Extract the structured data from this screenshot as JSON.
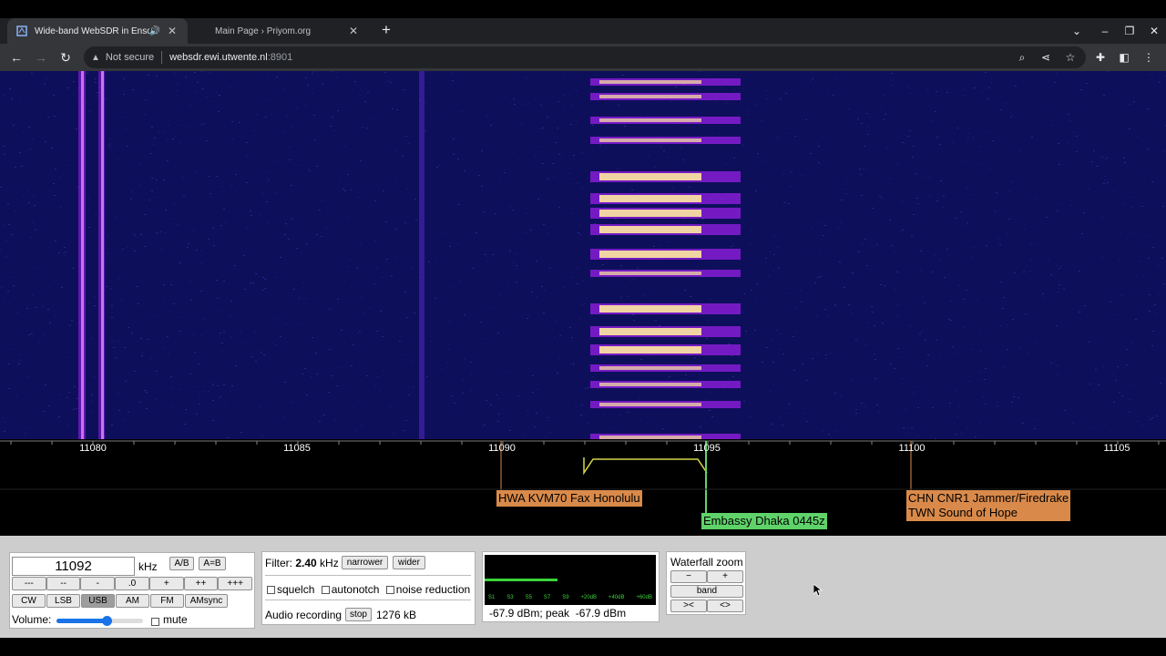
{
  "browser": {
    "tabs": [
      {
        "title": "Wide-band WebSDR in Ensch",
        "active": true,
        "audio": true
      },
      {
        "title": "Main Page › Priyom.org",
        "active": false
      }
    ],
    "address": {
      "security": "Not secure",
      "host": "websdr.ewi.utwente.nl",
      "port": ":8901"
    }
  },
  "waterfall": {
    "freq_ticks": [
      "11080",
      "11085",
      "11090",
      "11095",
      "11100",
      "11105"
    ],
    "colors": {
      "background": "#0e0f5a",
      "signal": "#ffe9a0",
      "mid": "#a020f0"
    }
  },
  "stations": [
    {
      "label": "HWA KVM70 Fax Honolulu",
      "color": "#d98a4a"
    },
    {
      "label": "Embassy Dhaka 0445z",
      "color": "#5fd36a"
    },
    {
      "label_line1": "CHN CNR1 Jammer/Firedrake",
      "label_line2": "TWN Sound of Hope",
      "color": "#d98a4a"
    }
  ],
  "tuning": {
    "frequency": "11092",
    "unit": "kHz",
    "ab": "A/B",
    "a_eq_b": "A=B",
    "step_buttons": [
      "---",
      "--",
      "-",
      ".0",
      "+",
      "++",
      "+++"
    ],
    "modes": [
      "CW",
      "LSB",
      "USB",
      "AM",
      "FM",
      "AMsync"
    ],
    "active_mode": "USB",
    "volume_label": "Volume:",
    "volume_level": 0.58,
    "mute_label": "mute"
  },
  "filter": {
    "label": "Filter:",
    "value": "2.40",
    "unit": "kHz",
    "narrower": "narrower",
    "wider": "wider",
    "squelch": "squelch",
    "autonotch": "autonotch",
    "noise_reduction": "noise reduction",
    "recording_label": "Audio recording",
    "stop": "stop",
    "recorded_size": "1276 kB"
  },
  "smeter": {
    "readout": "-67.9 dBm; peak  -67.9 dBm",
    "scale_labels": [
      "S1",
      "S3",
      "S5",
      "S7",
      "S9",
      "+20dB",
      "+40dB",
      "+60dB"
    ],
    "level_fraction": 0.45
  },
  "zoom": {
    "title": "Waterfall zoom",
    "minus": "−",
    "plus": "+",
    "band": "band",
    "narrow": "><",
    "wide": "<>"
  }
}
